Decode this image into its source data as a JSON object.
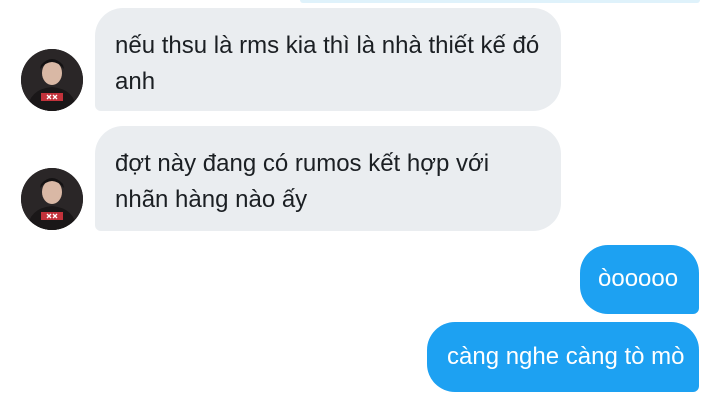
{
  "conversation": {
    "messages": [
      {
        "direction": "incoming",
        "text": "nếu thsu là rms kia thì là nhà thiết kế đó anh",
        "avatar": "user-avatar"
      },
      {
        "direction": "incoming",
        "text": "đợt này đang có rumos kết hợp với nhãn hàng nào ấy",
        "avatar": "user-avatar"
      },
      {
        "direction": "outgoing",
        "text": "òooooo"
      },
      {
        "direction": "outgoing",
        "text": "càng nghe càng tò mò"
      }
    ]
  },
  "colors": {
    "incoming_bubble": "#eaedf0",
    "outgoing_bubble": "#1da1f2",
    "incoming_text": "#1b1f23",
    "outgoing_text": "#ffffff"
  }
}
